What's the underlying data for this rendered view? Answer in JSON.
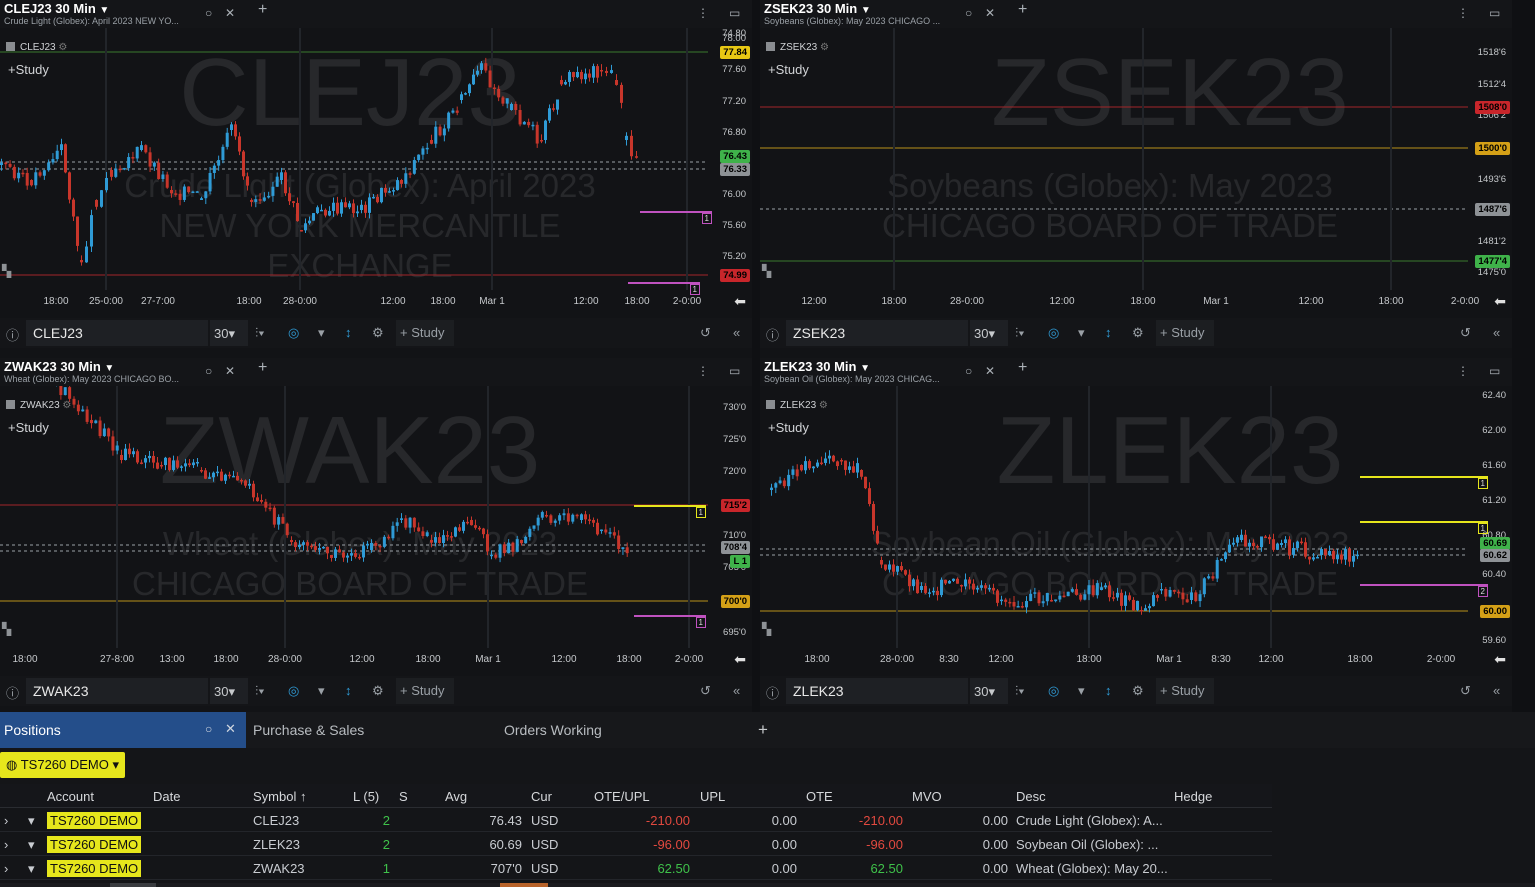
{
  "charts": [
    {
      "id": "clej",
      "title": "CLEJ23 30 Min",
      "subtitle": "Crude Light (Globex): April 2023 NEW YO...",
      "watermark_symbol": "CLEJ23",
      "watermark_desc_1": "Crude Light (Globex): April 2023",
      "watermark_desc_2": "NEW YORK MERCANTILE",
      "watermark_desc_3": "EXCHANGE",
      "legend_symbol": "CLEJ23",
      "study_label": "Study",
      "symbol_input": "CLEJ23",
      "interval": "30",
      "study_button": "Study",
      "y_ticks": [
        "78.00",
        "77.60",
        "77.20",
        "76.80",
        "76.40",
        "76.00",
        "75.60",
        "75.20",
        "74.80"
      ],
      "price_tags": [
        {
          "text": "77.84",
          "color": "#e8c814"
        },
        {
          "text": "76.43",
          "color": "#3fb24a"
        },
        {
          "text": "76.33",
          "color": "#8e9296"
        },
        {
          "text": "74.99",
          "color": "#c8262b"
        }
      ],
      "x_ticks": [
        "18:00",
        "25-0:00",
        "27-7:00",
        "18:00",
        "28-0:00",
        "12:00",
        "18:00",
        "Mar 1",
        "12:00",
        "18:00",
        "2-0:00"
      ],
      "order_labels": [
        "1",
        "1"
      ]
    },
    {
      "id": "zsek",
      "title": "ZSEK23 30 Min",
      "subtitle": "Soybeans (Globex): May 2023 CHICAGO ...",
      "watermark_symbol": "ZSEK23",
      "watermark_desc_1": "Soybeans (Globex): May 2023",
      "watermark_desc_2": "CHICAGO BOARD OF TRADE",
      "watermark_desc_3": "",
      "legend_symbol": "ZSEK23",
      "study_label": "Study",
      "symbol_input": "ZSEK23",
      "interval": "30",
      "study_button": "Study",
      "y_ticks": [
        "1518'6",
        "1512'4",
        "1506'2",
        "1500'0",
        "1493'6",
        "1487'6",
        "1481'2",
        "1475'0"
      ],
      "price_tags": [
        {
          "text": "1508'0",
          "color": "#c8262b"
        },
        {
          "text": "1500'0",
          "color": "#d4a017"
        },
        {
          "text": "1487'6",
          "color": "#8e9296"
        },
        {
          "text": "1477'4",
          "color": "#3fb24a"
        }
      ],
      "x_ticks": [
        "12:00",
        "18:00",
        "28-0:00",
        "12:00",
        "18:00",
        "Mar 1",
        "12:00",
        "18:00",
        "2-0:00"
      ],
      "order_labels": []
    },
    {
      "id": "zwak",
      "title": "ZWAK23 30 Min",
      "subtitle": "Wheat (Globex): May 2023 CHICAGO BO...",
      "watermark_symbol": "ZWAK23",
      "watermark_desc_1": "Wheat (Globex): May 2023",
      "watermark_desc_2": "CHICAGO BOARD OF TRADE",
      "watermark_desc_3": "",
      "legend_symbol": "ZWAK23",
      "study_label": "Study",
      "symbol_input": "ZWAK23",
      "interval": "30",
      "study_button": "Study",
      "y_ticks": [
        "730'0",
        "725'0",
        "720'0",
        "715'0",
        "710'0",
        "705'0",
        "700'0",
        "695'0"
      ],
      "price_tags": [
        {
          "text": "715'2",
          "color": "#c8262b"
        },
        {
          "text": "708'4",
          "color": "#8e9296"
        },
        {
          "text": "L 1",
          "color": "#3fb24a"
        },
        {
          "text": "700'0",
          "color": "#d4a017"
        }
      ],
      "x_ticks": [
        "18:00",
        "27-8:00",
        "13:00",
        "18:00",
        "28-0:00",
        "12:00",
        "18:00",
        "Mar 1",
        "12:00",
        "18:00",
        "2-0:00"
      ],
      "order_labels": [
        "1",
        "1"
      ]
    },
    {
      "id": "zlek",
      "title": "ZLEK23 30 Min",
      "subtitle": "Soybean Oil (Globex): May 2023 CHICAG...",
      "watermark_symbol": "ZLEK23",
      "watermark_desc_1": "Soybean Oil (Globex): May 2023",
      "watermark_desc_2": "CHICAGO BOARD OF TRADE",
      "watermark_desc_3": "",
      "legend_symbol": "ZLEK23",
      "study_label": "Study",
      "symbol_input": "ZLEK23",
      "interval": "30",
      "study_button": "Study",
      "y_ticks": [
        "62.40",
        "62.00",
        "61.60",
        "61.20",
        "60.80",
        "60.40",
        "60.00",
        "59.60"
      ],
      "price_tags": [
        {
          "text": "60.69",
          "color": "#3fb24a"
        },
        {
          "text": "60.62",
          "color": "#8e9296"
        },
        {
          "text": "60.00",
          "color": "#d4a017"
        }
      ],
      "x_ticks": [
        "18:00",
        "28-0:00",
        "8:30",
        "12:00",
        "18:00",
        "Mar 1",
        "8:30",
        "12:00",
        "18:00",
        "2-0:00"
      ],
      "order_labels": [
        "1",
        "1",
        "2"
      ]
    }
  ],
  "bottom": {
    "tabs": [
      "Positions",
      "Purchase & Sales",
      "Orders Working"
    ],
    "account_selector": "TS7260 DEMO",
    "columns": [
      "Account",
      "Date",
      "Symbol ↑",
      "L (5)",
      "S",
      "Avg",
      "Cur",
      "OTE/UPL",
      "UPL",
      "OTE",
      "MVO",
      "Desc",
      "Hedge"
    ],
    "rows": [
      {
        "account": "TS7260 DEMO",
        "date": "",
        "symbol": "CLEJ23",
        "long": "2",
        "short": "",
        "avg": "76.43",
        "cur": "USD",
        "ote_upl": "-210.00",
        "upl": "0.00",
        "ote": "-210.00",
        "mvo": "0.00",
        "desc": "Crude Light (Globex): A...",
        "hedge": ""
      },
      {
        "account": "TS7260 DEMO",
        "date": "",
        "symbol": "ZLEK23",
        "long": "2",
        "short": "",
        "avg": "60.69",
        "cur": "USD",
        "ote_upl": "-96.00",
        "upl": "0.00",
        "ote": "-96.00",
        "mvo": "0.00",
        "desc": "Soybean Oil (Globex): ...",
        "hedge": ""
      },
      {
        "account": "TS7260 DEMO",
        "date": "",
        "symbol": "ZWAK23",
        "long": "1",
        "short": "",
        "avg": "707'0",
        "cur": "USD",
        "ote_upl": "62.50",
        "upl": "0.00",
        "ote": "62.50",
        "mvo": "0.00",
        "desc": "Wheat (Globex): May 20...",
        "hedge": ""
      }
    ]
  },
  "colors": {
    "up": "#2f9bd6",
    "down": "#c8362b",
    "accent": "#244e8a",
    "account_pill": "#e6e61c"
  }
}
